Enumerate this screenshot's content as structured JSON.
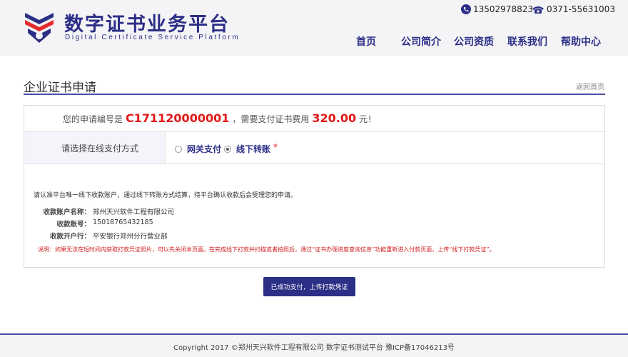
{
  "header": {
    "logo_title": "数字证书业务平台",
    "logo_subtitle": "Digital Certificate Service Platform",
    "phone_mobile": "13502978823",
    "phone_landline": "0371-55631003",
    "nav": [
      "首页",
      "公司简介",
      "公司资质",
      "联系我们",
      "帮助中心"
    ]
  },
  "section": {
    "title": "企业证书申请",
    "back_link": "返回首页"
  },
  "application": {
    "prefix": "您的申请编号是",
    "number": "C171120000001",
    "middle": "，需要支付证书费用",
    "amount": "320.00",
    "suffix": "元！"
  },
  "payment": {
    "label": "请选择在线支付方式",
    "options": [
      {
        "label": "网关支付",
        "selected": false
      },
      {
        "label": "线下转账",
        "selected": true
      }
    ],
    "required_mark": "*"
  },
  "transfer": {
    "info": "请认准平台唯一线下收款账户，通过线下转账方式结算，待平台确认收款后会受理您的申请。",
    "fields": [
      {
        "key": "收款账户名称：",
        "value": "郑州天兴软件工程有限公司"
      },
      {
        "key": "收款账号：",
        "value": "15018765432185"
      },
      {
        "key": "收款开户行：",
        "value": "平安银行郑州分行营业部"
      }
    ],
    "note": "说明：如果无法在短时间内获取打款凭证照片，可以先关闭本页面。在完成线下打款并扫描或者拍照后，通过“证书办理进度查询信息”功能重新进入付款页面，上传“线下打款凭证”。"
  },
  "actions": {
    "upload_button": "已成功支付，上传打款凭证"
  },
  "footer": {
    "text": "Copyright 2017 ©郑州天兴软件工程有限公司 数字证书测试平台 豫ICP备17046213号"
  },
  "colors": {
    "brand": "#2c2f86",
    "accent_red": "#e11818",
    "note_red": "#d22020"
  }
}
